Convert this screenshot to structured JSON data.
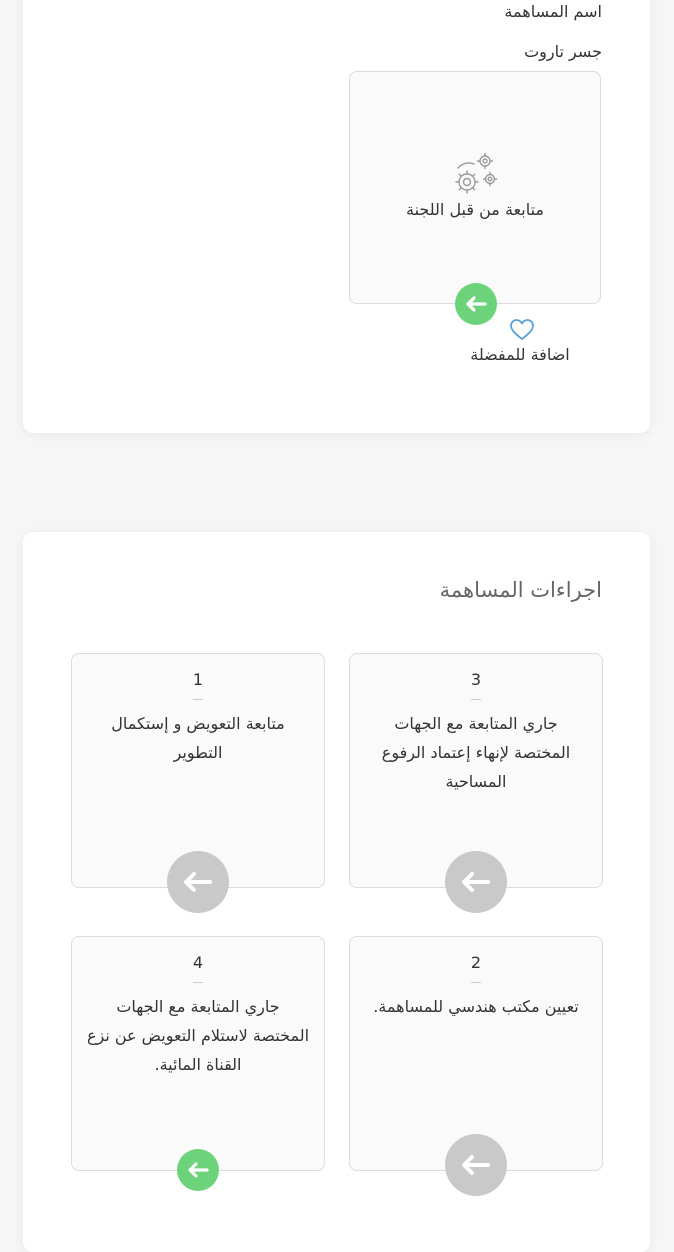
{
  "contribution": {
    "name_label": "اسم المساهمة",
    "name_value": "جسر تاروت",
    "status": {
      "text": "متابعة من قبل اللجنة",
      "icon": "gears-icon"
    },
    "favorite_label": "اضافة للمفضلة"
  },
  "procedures": {
    "title": "اجراءات المساهمة",
    "steps": [
      {
        "number": "3",
        "text": "جاري المتابعة مع الجهات المختصة لإنهاء إعتماد الرفوع المساحية",
        "state": "pending"
      },
      {
        "number": "1",
        "text": "متابعة التعويض و إستكمال التطوير",
        "state": "pending"
      },
      {
        "number": "2",
        "text": "تعيين مكتب هندسي للمساهمة.",
        "state": "pending"
      },
      {
        "number": "4",
        "text": "جاري المتابعة مع الجهات المختصة لاستلام التعويض عن نزع القناة المائية.",
        "state": "active"
      }
    ]
  },
  "colors": {
    "active": "#6cd37a",
    "pending": "#c9c9c9",
    "heart": "#5aa2d6"
  }
}
